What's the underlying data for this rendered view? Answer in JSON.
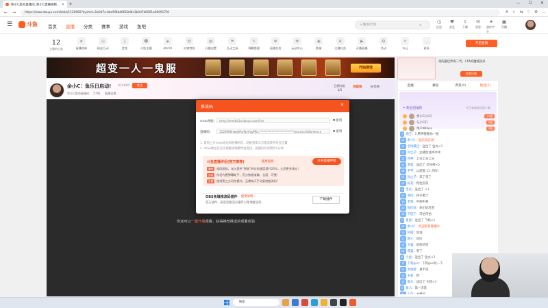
{
  "browser": {
    "tab_title": "余小C是的直播间_余小C直播视频...",
    "tab_close": "✕",
    "new_tab": "+",
    "url": "https://www.douyu.com/beta/1126960?dyshid=1b0d7a-bbd5f8b46618d6c3b0d7b6001a00091701",
    "window_controls": [
      "—",
      "☐",
      "✕"
    ],
    "nav": [
      "←",
      "→",
      "⟳"
    ],
    "icons": [
      "A",
      "☆",
      "⇆",
      "♡",
      "⚙",
      "…"
    ]
  },
  "header": {
    "menu_icon": "☰",
    "logo_text": "斗鱼",
    "nav": [
      "首页",
      "直播",
      "分类",
      "赛事",
      "游戏",
      "鱼吧"
    ],
    "search_placeholder": "三角洲行动",
    "search_icon": "⌕",
    "tools": [
      {
        "icon": "◷",
        "label": "历史"
      },
      {
        "icon": "♥",
        "label": "关注"
      },
      {
        "icon": "⇩",
        "label": "下载"
      },
      {
        "icon": "✉",
        "label": "消息"
      },
      {
        "icon": "✦",
        "label": "创作中心"
      },
      {
        "icon": "▣",
        "label": "开播"
      }
    ]
  },
  "categories": {
    "follow_count": "12",
    "follow_label": "主播的分类",
    "items": [
      {
        "icon": "★",
        "label": "直播榜单"
      },
      {
        "icon": "◎",
        "label": "粉丝互动"
      },
      {
        "icon": "♫",
        "label": "音频"
      },
      {
        "icon": "☻",
        "label": "斗鱼主播"
      },
      {
        "icon": "◈",
        "label": "AR/VR"
      },
      {
        "icon": "✿",
        "label": "礼物特效"
      },
      {
        "icon": "▤",
        "label": "开播设置"
      },
      {
        "icon": "⚑",
        "label": "互动工具"
      },
      {
        "icon": "✎",
        "label": "弹幕管理"
      },
      {
        "icon": "❖",
        "label": "直播任务"
      },
      {
        "icon": "✚",
        "label": "玩法中心"
      },
      {
        "icon": "◉",
        "label": "赛事"
      },
      {
        "icon": "♛",
        "label": "主播任务"
      },
      {
        "icon": "▶",
        "label": "开播直播"
      },
      {
        "icon": "✪",
        "label": "活动"
      },
      {
        "icon": "☀",
        "label": "节日"
      },
      {
        "icon": "…",
        "label": "更多"
      }
    ],
    "live_button": "开启直播"
  },
  "banner": {
    "title": "超变一人一鬼服",
    "button": "开始游戏"
  },
  "ad": {
    "text": "来的最佳传奇二代，CPA的魔域热点",
    "button": "查看详情"
  },
  "room": {
    "title": "余小C：鱼乐日启动!",
    "room_id": "914900",
    "follow_label": "关注",
    "sub": [
      "余小C是的直播间",
      "5791",
      "直播设置"
    ],
    "rank_label": "日榜排名",
    "rank_value": "4/5",
    "rank_tabs": [
      "贡献榜",
      "分享榜"
    ]
  },
  "video": {
    "note_pre": "你还可以",
    "note_link": "一键开播",
    "note_post": "观看，获得推荐推送的观看体验"
  },
  "sidebar": {
    "tabs": [
      "直播",
      "赛程",
      "贵宾(0)",
      "粉丝(1)"
    ],
    "fans_title": "✦ 粉丝团福利",
    "fans_right": "今日有效粉丝团人数",
    "fans": [
      {
        "name": "余小C(小C)",
        "tag": "10级"
      },
      {
        "name": "与小C们",
        "tag": "6级"
      },
      {
        "name": "用户中Pass",
        "tag": "3级"
      }
    ],
    "messages": [
      {
        "lv": "7",
        "name": "酒王",
        "text": "：1 腾神我敬你一瓶",
        "hl": false
      },
      {
        "lv": "25",
        "name": "余小C",
        "text": "：鱼乐日启动！",
        "hl": true
      },
      {
        "lv": "12",
        "name": "全场最佳",
        "text": "：送出了 鱼丸×1",
        "hl": false
      },
      {
        "lv": "15",
        "name": "风之子",
        "text": "：主播加油冲冲冲",
        "hl": false
      },
      {
        "lv": "14",
        "name": "月神",
        "text": "：上分上分上分",
        "hl": false
      },
      {
        "lv": "12",
        "name": "游客",
        "text": "：送出了 荧光棒×5",
        "hl": false
      },
      {
        "lv": "18",
        "name": "平平",
        "text": "：以前都 11 点吗?",
        "hl": false
      },
      {
        "lv": "21",
        "name": "风之子",
        "text": "：来了来了",
        "hl": false
      },
      {
        "lv": "12",
        "name": "好友",
        "text": "：稳住别浪",
        "hl": false
      },
      {
        "lv": "9",
        "name": "无名",
        "text": "：送出了 ×1",
        "hl": false
      },
      {
        "lv": "22",
        "name": "清风",
        "text": "：耗子尾汁",
        "hl": false
      },
      {
        "lv": "16",
        "name": "老铁",
        "text": "：牛啊牛啊",
        "hl": false
      },
      {
        "lv": "20",
        "name": "你们好",
        "text": "：你们好厉害",
        "hl": false
      },
      {
        "lv": "19",
        "name": "下班了",
        "text": "：可怕可怕",
        "hl": false
      },
      {
        "lv": "7",
        "name": "星星",
        "text": "：送出了 飞机×1",
        "hl": false
      },
      {
        "lv": "25",
        "name": "余小C",
        "text": "：欢迎来到直播间",
        "hl": true
      },
      {
        "lv": "13",
        "name": "阿喵",
        "text": "：加油",
        "hl": false
      },
      {
        "lv": "11",
        "name": "路人",
        "text": "：666",
        "hl": false
      },
      {
        "lv": "12",
        "name": "大猫",
        "text": "：哈哈哈哈",
        "hl": false
      },
      {
        "lv": "24",
        "name": "夜猫",
        "text": "：来了",
        "hl": false
      },
      {
        "lv": "8",
        "name": "小鱼",
        "text": "：送出了 鱼丸×2",
        "hl": false
      },
      {
        "lv": "17",
        "name": "下到gun",
        "text": "：下到gun玩一下",
        "hl": false
      },
      {
        "lv": "14",
        "name": "旁观者",
        "text": "：真不错",
        "hl": false
      },
      {
        "lv": "10",
        "name": "王者",
        "text": "：稳",
        "hl": false
      },
      {
        "lv": "12",
        "name": "观众",
        "text": "：送出了 礼物×1",
        "hl": false
      },
      {
        "lv": "9",
        "name": "新人",
        "text": "：第一次来",
        "hl": false
      },
      {
        "lv": "12",
        "name": "小白",
        "text": "：主播好",
        "hl": false
      },
      {
        "lv": "19",
        "name": "老粉",
        "text": "：冲冲冲",
        "hl": false
      },
      {
        "lv": "22",
        "name": "飞鱼",
        "text": "：好家伙",
        "hl": false
      }
    ]
  },
  "modal": {
    "title": "推流码",
    "close": "✕",
    "rtmp_label": "rtmp地址：",
    "rtmp_value": "rtmp://sendtc1a.douyu.com/live",
    "key_label": "直播码：",
    "key_value": "1126960rtwe6AnWyVqyPB=*************************wcord=0x8xmimcn",
    "copy": "复制",
    "notes": [
      "1. 复制上方rtmp地址和直播码后，粘贴到第三方推流软件对应位置",
      "2. rtmp地址仅在切换推流线路时会变化，直播码有效期为1分钟"
    ],
    "promo_title": "斗鱼直播伴侣(官方推荐)",
    "promo_link": "使用说明 ›",
    "promo_button": "打开直播伴侣",
    "promo_items": [
      {
        "tag": "清晰",
        "text": "相同画质，永久提供“原画”的位码速度提升20%，让您更多观众!"
      },
      {
        "tag": "互动",
        "text": "伴侣内置弹幕助手，官方数据准确、全面、可靠!"
      },
      {
        "tag": "方便",
        "text": "使用第三方码控模式，无需每天手动复制推流码!"
      }
    ],
    "obs_title": "OBS免填推流码插件",
    "obs_link": "使用说明 ›",
    "obs_desc": "官方插件，安装后推流开播可以免填推流码",
    "obs_button": "下载插件"
  },
  "taskbar": {
    "search": "搜索",
    "app_colors": [
      "#e9a04a",
      "#3a7bd5",
      "#d84a3a",
      "#2f9ed8",
      "#f2b233",
      "#444444",
      "#222222",
      "#f05a28"
    ]
  }
}
